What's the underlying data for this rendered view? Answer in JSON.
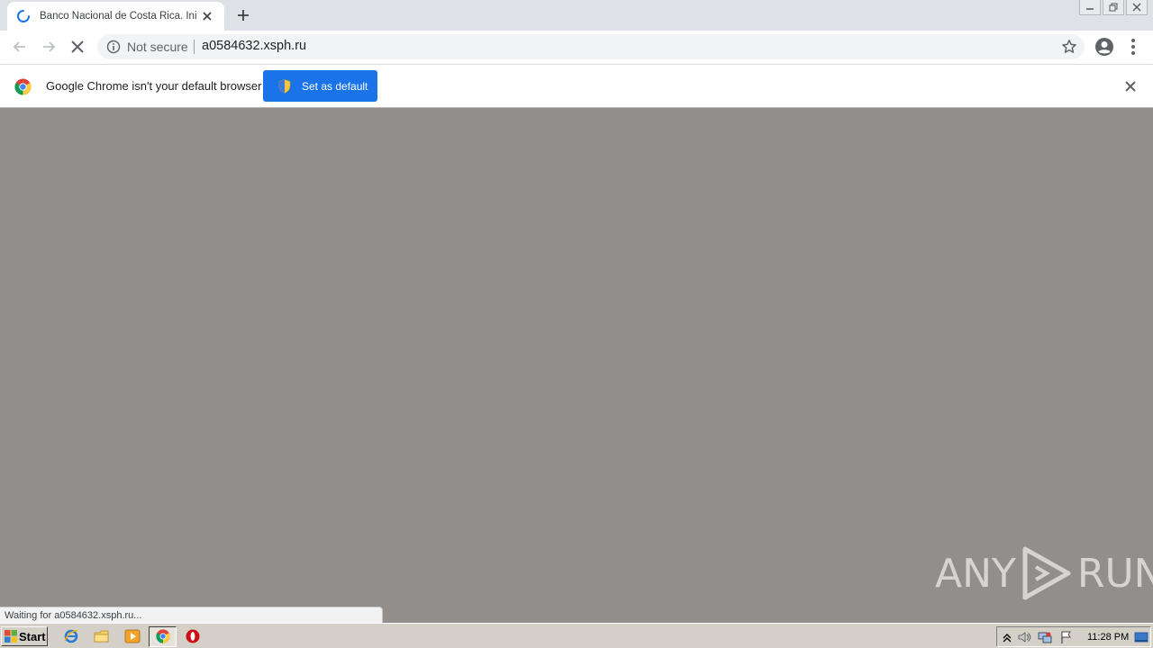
{
  "browser": {
    "tab": {
      "title": "Banco Nacional de Costa Rica. Inicio",
      "close_icon": "close-icon",
      "loading_icon": "spinner-icon"
    },
    "new_tab_label": "+",
    "window_controls": [
      "minimize-icon",
      "restore-icon",
      "close-icon"
    ],
    "toolbar": {
      "back_icon": "back-arrow-icon",
      "forward_icon": "forward-arrow-icon",
      "stop_icon": "stop-loading-icon",
      "security_label": "Not secure",
      "url": "a0584632.xsph.ru",
      "bookmark_icon": "star-icon",
      "profile_icon": "account-icon",
      "menu_icon": "kebab-menu-icon"
    },
    "infobar": {
      "message": "Google Chrome isn't your default browser",
      "button_label": "Set as default",
      "close_icon": "close-icon"
    },
    "status_text": "Waiting for a0584632.xsph.ru...",
    "watermark": {
      "left": "ANY",
      "right": "RUN"
    }
  },
  "taskbar": {
    "start_label": "Start",
    "apps": [
      "internet-explorer-icon",
      "explorer-folder-icon",
      "media-player-icon",
      "chrome-icon",
      "opera-icon"
    ],
    "active_app": "chrome-icon",
    "clock": "11:28 PM",
    "tray_icons": [
      "show-hidden-icon",
      "volume-icon",
      "network-icon",
      "action-center-flag-icon",
      "show-desktop-icon"
    ]
  },
  "colors": {
    "content_bg": "#928e8b",
    "accent": "#1a73e8",
    "tabstrip": "#dee1e6"
  }
}
